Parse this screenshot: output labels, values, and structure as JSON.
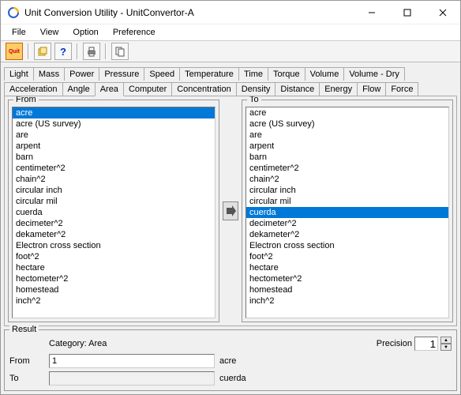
{
  "window": {
    "title": "Unit Conversion Utility - UnitConvertor-A"
  },
  "menu": {
    "items": [
      "File",
      "View",
      "Option",
      "Preference"
    ]
  },
  "toolbar": {
    "buttons": [
      "Quit",
      "Copy",
      "Help",
      "Print",
      "CopyAll"
    ]
  },
  "tabs": {
    "row1": [
      "Light",
      "Mass",
      "Power",
      "Pressure",
      "Speed",
      "Temperature",
      "Time",
      "Torque",
      "Volume",
      "Volume - Dry"
    ],
    "row2": [
      "Acceleration",
      "Angle",
      "Area",
      "Computer",
      "Concentration",
      "Density",
      "Distance",
      "Energy",
      "Flow",
      "Force"
    ],
    "active": "Area"
  },
  "from": {
    "label": "From",
    "selected": "acre",
    "items": [
      "acre",
      "acre (US survey)",
      "are",
      "arpent",
      "barn",
      "centimeter^2",
      "chain^2",
      "circular inch",
      "circular mil",
      "cuerda",
      "decimeter^2",
      "dekameter^2",
      "Electron cross section",
      "foot^2",
      "hectare",
      "hectometer^2",
      "homestead",
      "inch^2"
    ]
  },
  "to": {
    "label": "To",
    "selected": "cuerda",
    "items": [
      "acre",
      "acre (US survey)",
      "are",
      "arpent",
      "barn",
      "centimeter^2",
      "chain^2",
      "circular inch",
      "circular mil",
      "cuerda",
      "decimeter^2",
      "dekameter^2",
      "Electron cross section",
      "foot^2",
      "hectare",
      "hectometer^2",
      "homestead",
      "inch^2"
    ]
  },
  "result": {
    "label": "Result",
    "category_label": "Category:",
    "category_value": "Area",
    "precision_label": "Precision",
    "precision_value": "1",
    "from_label": "From",
    "from_value": "1",
    "from_unit": "acre",
    "to_label": "To",
    "to_value": "",
    "to_unit": "cuerda"
  }
}
